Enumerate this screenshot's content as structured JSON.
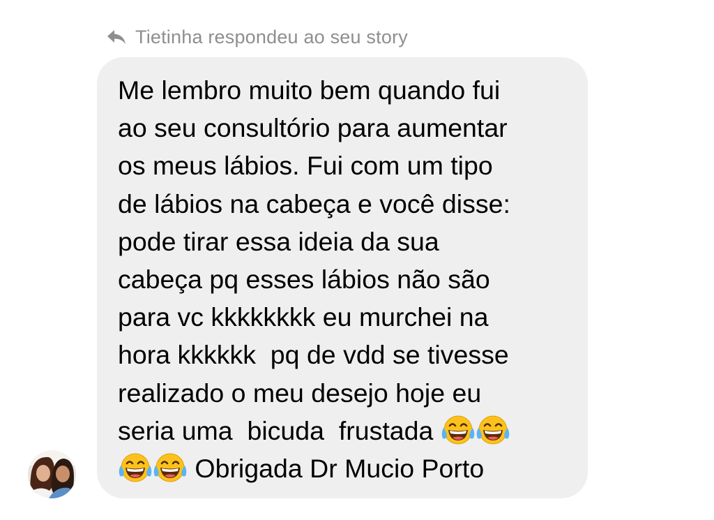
{
  "reply_header": {
    "icon": "reply-arrow-icon",
    "text": "Tietinha respondeu ao seu story"
  },
  "message": {
    "lines": [
      "Me lembro muito bem quando fui",
      "ao seu consultório para aumentar",
      "os meus lábios. Fui com um tipo",
      "de lábios na cabeça e você disse:",
      "pode tirar essa ideia da sua",
      "cabeça pq esses lábios não são",
      "para vc kkkkkkkk eu murchei na",
      "hora kkkkkk  pq de vdd se tivesse",
      "realizado o meu desejo hoje eu",
      "seria uma  bicuda  frustada",
      "Obrigada Dr Mucio Porto"
    ],
    "emoji": "face-with-tears-of-joy"
  },
  "sender": {
    "avatar_icon": "profile-photo-avatar"
  },
  "colors": {
    "bubble_bg": "#efefef",
    "header_text": "#8e8e8e",
    "message_text": "#000000"
  }
}
